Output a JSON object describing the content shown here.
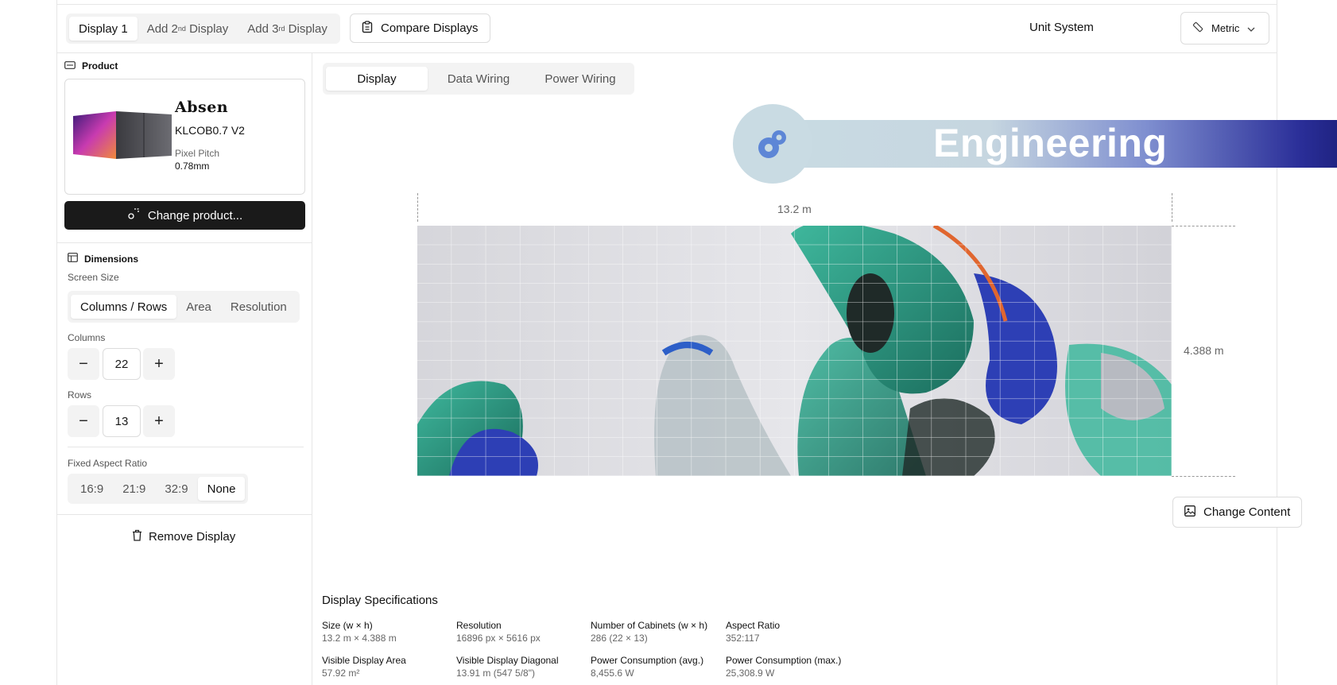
{
  "topbar": {
    "tabs": [
      {
        "label": "Display 1"
      },
      {
        "prefix": "Add 2",
        "sup": "nd",
        "suffix": " Display"
      },
      {
        "prefix": "Add 3",
        "sup": "rd",
        "suffix": " Display"
      }
    ],
    "compare_label": "Compare Displays",
    "unit_system_label": "Unit System",
    "unit_value": "Metric"
  },
  "sidebar": {
    "product_title": "Product",
    "brand": "Absen",
    "model": "KLCOB0.7 V2",
    "pitch_label": "Pixel Pitch",
    "pitch_value": "0.78mm",
    "change_product_label": "Change product...",
    "dimensions_title": "Dimensions",
    "screen_size_label": "Screen Size",
    "size_modes": [
      "Columns / Rows",
      "Area",
      "Resolution"
    ],
    "columns_label": "Columns",
    "columns_value": "22",
    "rows_label": "Rows",
    "rows_value": "13",
    "aspect_label": "Fixed Aspect Ratio",
    "aspect_options": [
      "16:9",
      "21:9",
      "32:9",
      "None"
    ],
    "remove_label": "Remove Display"
  },
  "main": {
    "view_tabs": [
      "Display",
      "Data Wiring",
      "Power Wiring"
    ],
    "banner_text": "Engineering",
    "width_dim": "13.2 m",
    "height_dim": "4.388 m",
    "change_content_label": "Change Content",
    "specs_title": "Display Specifications",
    "specs": [
      {
        "label": "Size (w × h)",
        "value": "13.2 m × 4.388 m"
      },
      {
        "label": "Resolution",
        "value": "16896 px × 5616 px"
      },
      {
        "label": "Number of Cabinets (w × h)",
        "value": "286 (22 × 13)"
      },
      {
        "label": "Aspect Ratio",
        "value": "352:117"
      },
      {
        "label": "Visible Display Area",
        "value": "57.92 m²"
      },
      {
        "label": "Visible Display Diagonal",
        "value": "13.91 m (547 5/8\")"
      },
      {
        "label": "Power Consumption (avg.)",
        "value": "8,455.6 W"
      },
      {
        "label": "Power Consumption (max.)",
        "value": "25,308.9 W"
      }
    ]
  },
  "colors": {
    "accent_dark": "#1a1a1a",
    "banner_light": "#c9dbe3",
    "banner_dark": "#1c1f7a",
    "gear": "#5d86d6"
  }
}
